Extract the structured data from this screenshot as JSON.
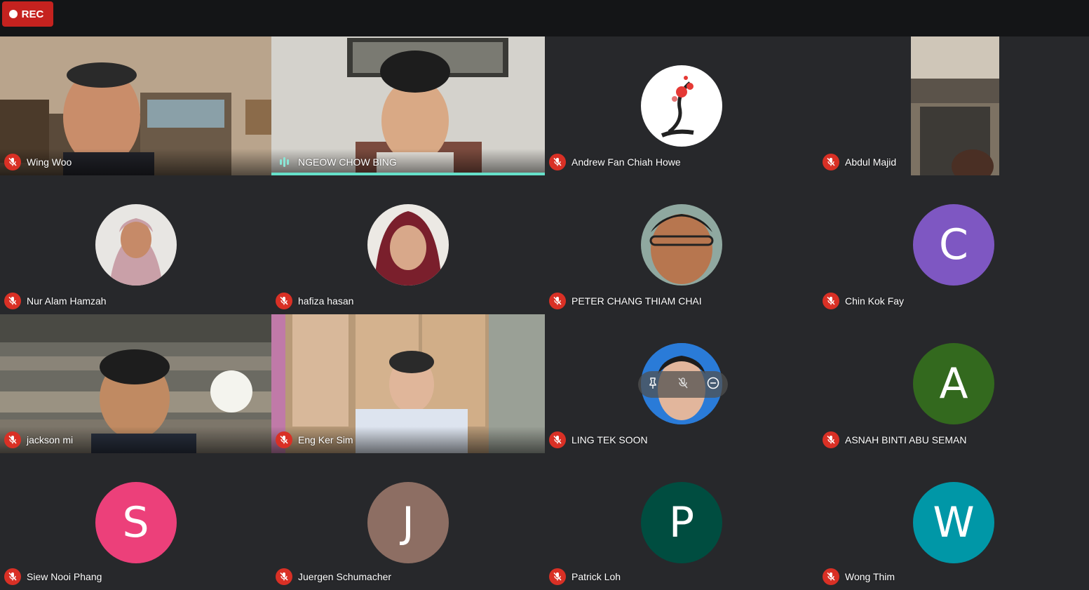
{
  "recording": {
    "label": "REC"
  },
  "participants": [
    {
      "name": "Wing Woo",
      "muted": true,
      "kind": "video"
    },
    {
      "name": "NGEOW CHOW BING",
      "muted": false,
      "speaking": true,
      "kind": "video"
    },
    {
      "name": "Andrew Fan Chiah Howe",
      "muted": true,
      "kind": "avatar",
      "avatar_image": "plum-blossom-painting"
    },
    {
      "name": "Abdul Majid",
      "muted": true,
      "kind": "video"
    },
    {
      "name": "Nur Alam Hamzah",
      "muted": true,
      "kind": "avatar",
      "avatar_image": "photo-hijab-glasses"
    },
    {
      "name": "hafiza hasan",
      "muted": true,
      "kind": "avatar",
      "avatar_image": "photo-hijab-maroon"
    },
    {
      "name": "PETER CHANG THIAM CHAI",
      "muted": true,
      "kind": "avatar",
      "avatar_image": "photo-man-glasses"
    },
    {
      "name": "Chin Kok Fay",
      "muted": true,
      "kind": "avatar",
      "initial": "C",
      "color": "#7e57c2"
    },
    {
      "name": "jackson mi",
      "muted": true,
      "kind": "video"
    },
    {
      "name": "Eng Ker Sim",
      "muted": true,
      "kind": "video"
    },
    {
      "name": "LING TEK SOON",
      "muted": true,
      "kind": "avatar",
      "avatar_image": "photo-young-man"
    },
    {
      "name": "ASNAH BINTI ABU SEMAN",
      "muted": true,
      "kind": "avatar",
      "initial": "A",
      "color": "#33691e"
    },
    {
      "name": "Siew Nooi Phang",
      "muted": true,
      "kind": "avatar",
      "initial": "S",
      "color": "#ec407a"
    },
    {
      "name": "Juergen Schumacher",
      "muted": true,
      "kind": "avatar",
      "initial": "J",
      "color": "#8d6e63"
    },
    {
      "name": "Patrick Loh",
      "muted": true,
      "kind": "avatar",
      "initial": "P",
      "color": "#004d40"
    },
    {
      "name": "Wong Thim",
      "muted": true,
      "kind": "avatar",
      "initial": "W",
      "color": "#0097a7"
    }
  ],
  "hover_controls": [
    "pin-icon",
    "mic-off-icon",
    "remove-icon"
  ],
  "colors": {
    "background": "#202124",
    "mute": "#d93025",
    "speaker_accent": "#66e0c9",
    "rec": "#c5221f"
  }
}
